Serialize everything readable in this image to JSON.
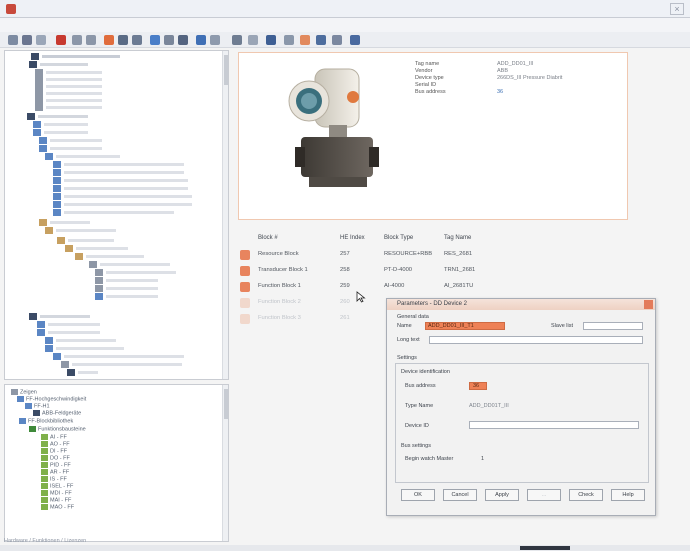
{
  "device": {
    "properties": [
      {
        "label": "Tag name",
        "value": "ADD_DD01_III"
      },
      {
        "label": "Vendor",
        "value": "ABB"
      },
      {
        "label": "Device type",
        "value": "266DS_III Pressure Diabrit"
      },
      {
        "label": "Serial ID",
        "value": ""
      },
      {
        "label": "Bus address",
        "value": "36"
      }
    ]
  },
  "table": {
    "headers": [
      "Block #",
      "HE Index",
      "Block Type",
      "Tag Name"
    ],
    "rows": [
      {
        "name": "Resource Block",
        "index": "257",
        "type": "RESOURCE+RBB",
        "tag": "RES_2681",
        "active": true
      },
      {
        "name": "Transducer Block 1",
        "index": "258",
        "type": "PT-D-4000",
        "tag": "TRN1_2681",
        "active": true
      },
      {
        "name": "Function Block 1",
        "index": "259",
        "type": "AI-4000",
        "tag": "AI_2681TU",
        "active": true
      },
      {
        "name": "Function Block 2",
        "index": "260",
        "type": "",
        "tag": "",
        "active": false
      },
      {
        "name": "Function Block 3",
        "index": "261",
        "type": "",
        "tag": "",
        "active": false
      }
    ]
  },
  "dialog": {
    "title": "Parameters - DD Device 2",
    "section_general": "General data",
    "name_label": "Name",
    "name_value": "ADD_DD01_III_T1",
    "slot_label": "Slave list",
    "long_label": "Long text",
    "section_settings": "Settings",
    "section_identification": "Device identification",
    "bus_address_label": "Bus address",
    "bus_address_value": "36",
    "type_name_label": "Type Name",
    "type_name_value": "ADD_DD01T_III",
    "device_id_label": "Device ID",
    "section_bus": "Bus settings",
    "bus_param_label": "Begin watch Master",
    "bus_param_value": "1",
    "buttons": {
      "ok": "OK",
      "cancel": "Cancel",
      "apply": "Apply",
      "check": "Check",
      "help": "Help",
      "disabled": "..."
    }
  },
  "hierarchy": {
    "items": [
      "Zeigen",
      "FF-Hochgeschwindigkeit",
      "FF-H1",
      "ABB-Feldgeräte",
      "FF-Blockbibliothek",
      "Funktionsbausteine",
      "AI - FF",
      "AO - FF",
      "DI - FF",
      "DO - FF",
      "PID - FF",
      "AR - FF",
      "IS - FF",
      "ISEL - FF",
      "MDI - FF",
      "MAI - FF",
      "MAO - FF"
    ]
  },
  "bottom_tabs": "Hardware  /  Funktionen  /  Lizenzen"
}
